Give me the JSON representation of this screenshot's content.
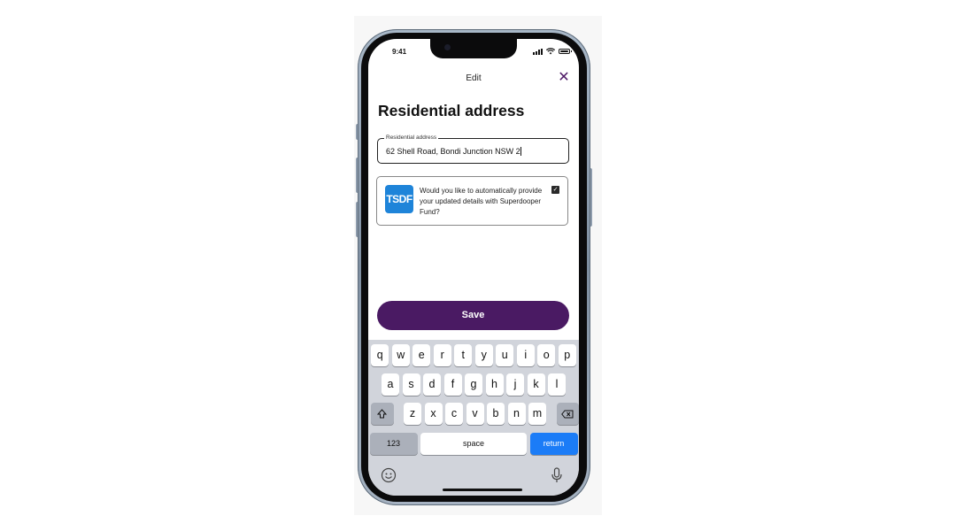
{
  "status_bar": {
    "time": "9:41"
  },
  "header": {
    "title": "Edit",
    "close_label": "✕"
  },
  "page": {
    "title": "Residential address"
  },
  "address_field": {
    "label": "Residential address",
    "value": "62 Shell Road, Bondi Junction NSW 2"
  },
  "consent": {
    "logo_text": "TSDF",
    "text": "Would you like to automatically provide your updated details with Superdooper Fund?",
    "checked": true
  },
  "save_button": {
    "label": "Save"
  },
  "keyboard": {
    "row1": [
      "q",
      "w",
      "e",
      "r",
      "t",
      "y",
      "u",
      "i",
      "o",
      "p"
    ],
    "row2": [
      "a",
      "s",
      "d",
      "f",
      "g",
      "h",
      "j",
      "k",
      "l"
    ],
    "row3": [
      "z",
      "x",
      "c",
      "v",
      "b",
      "n",
      "m"
    ],
    "numbers_label": "123",
    "space_label": "space",
    "return_label": "return"
  },
  "colors": {
    "accent": "#4a1a63",
    "logo_blue": "#1e84d9",
    "return_blue": "#1b7cf7"
  }
}
